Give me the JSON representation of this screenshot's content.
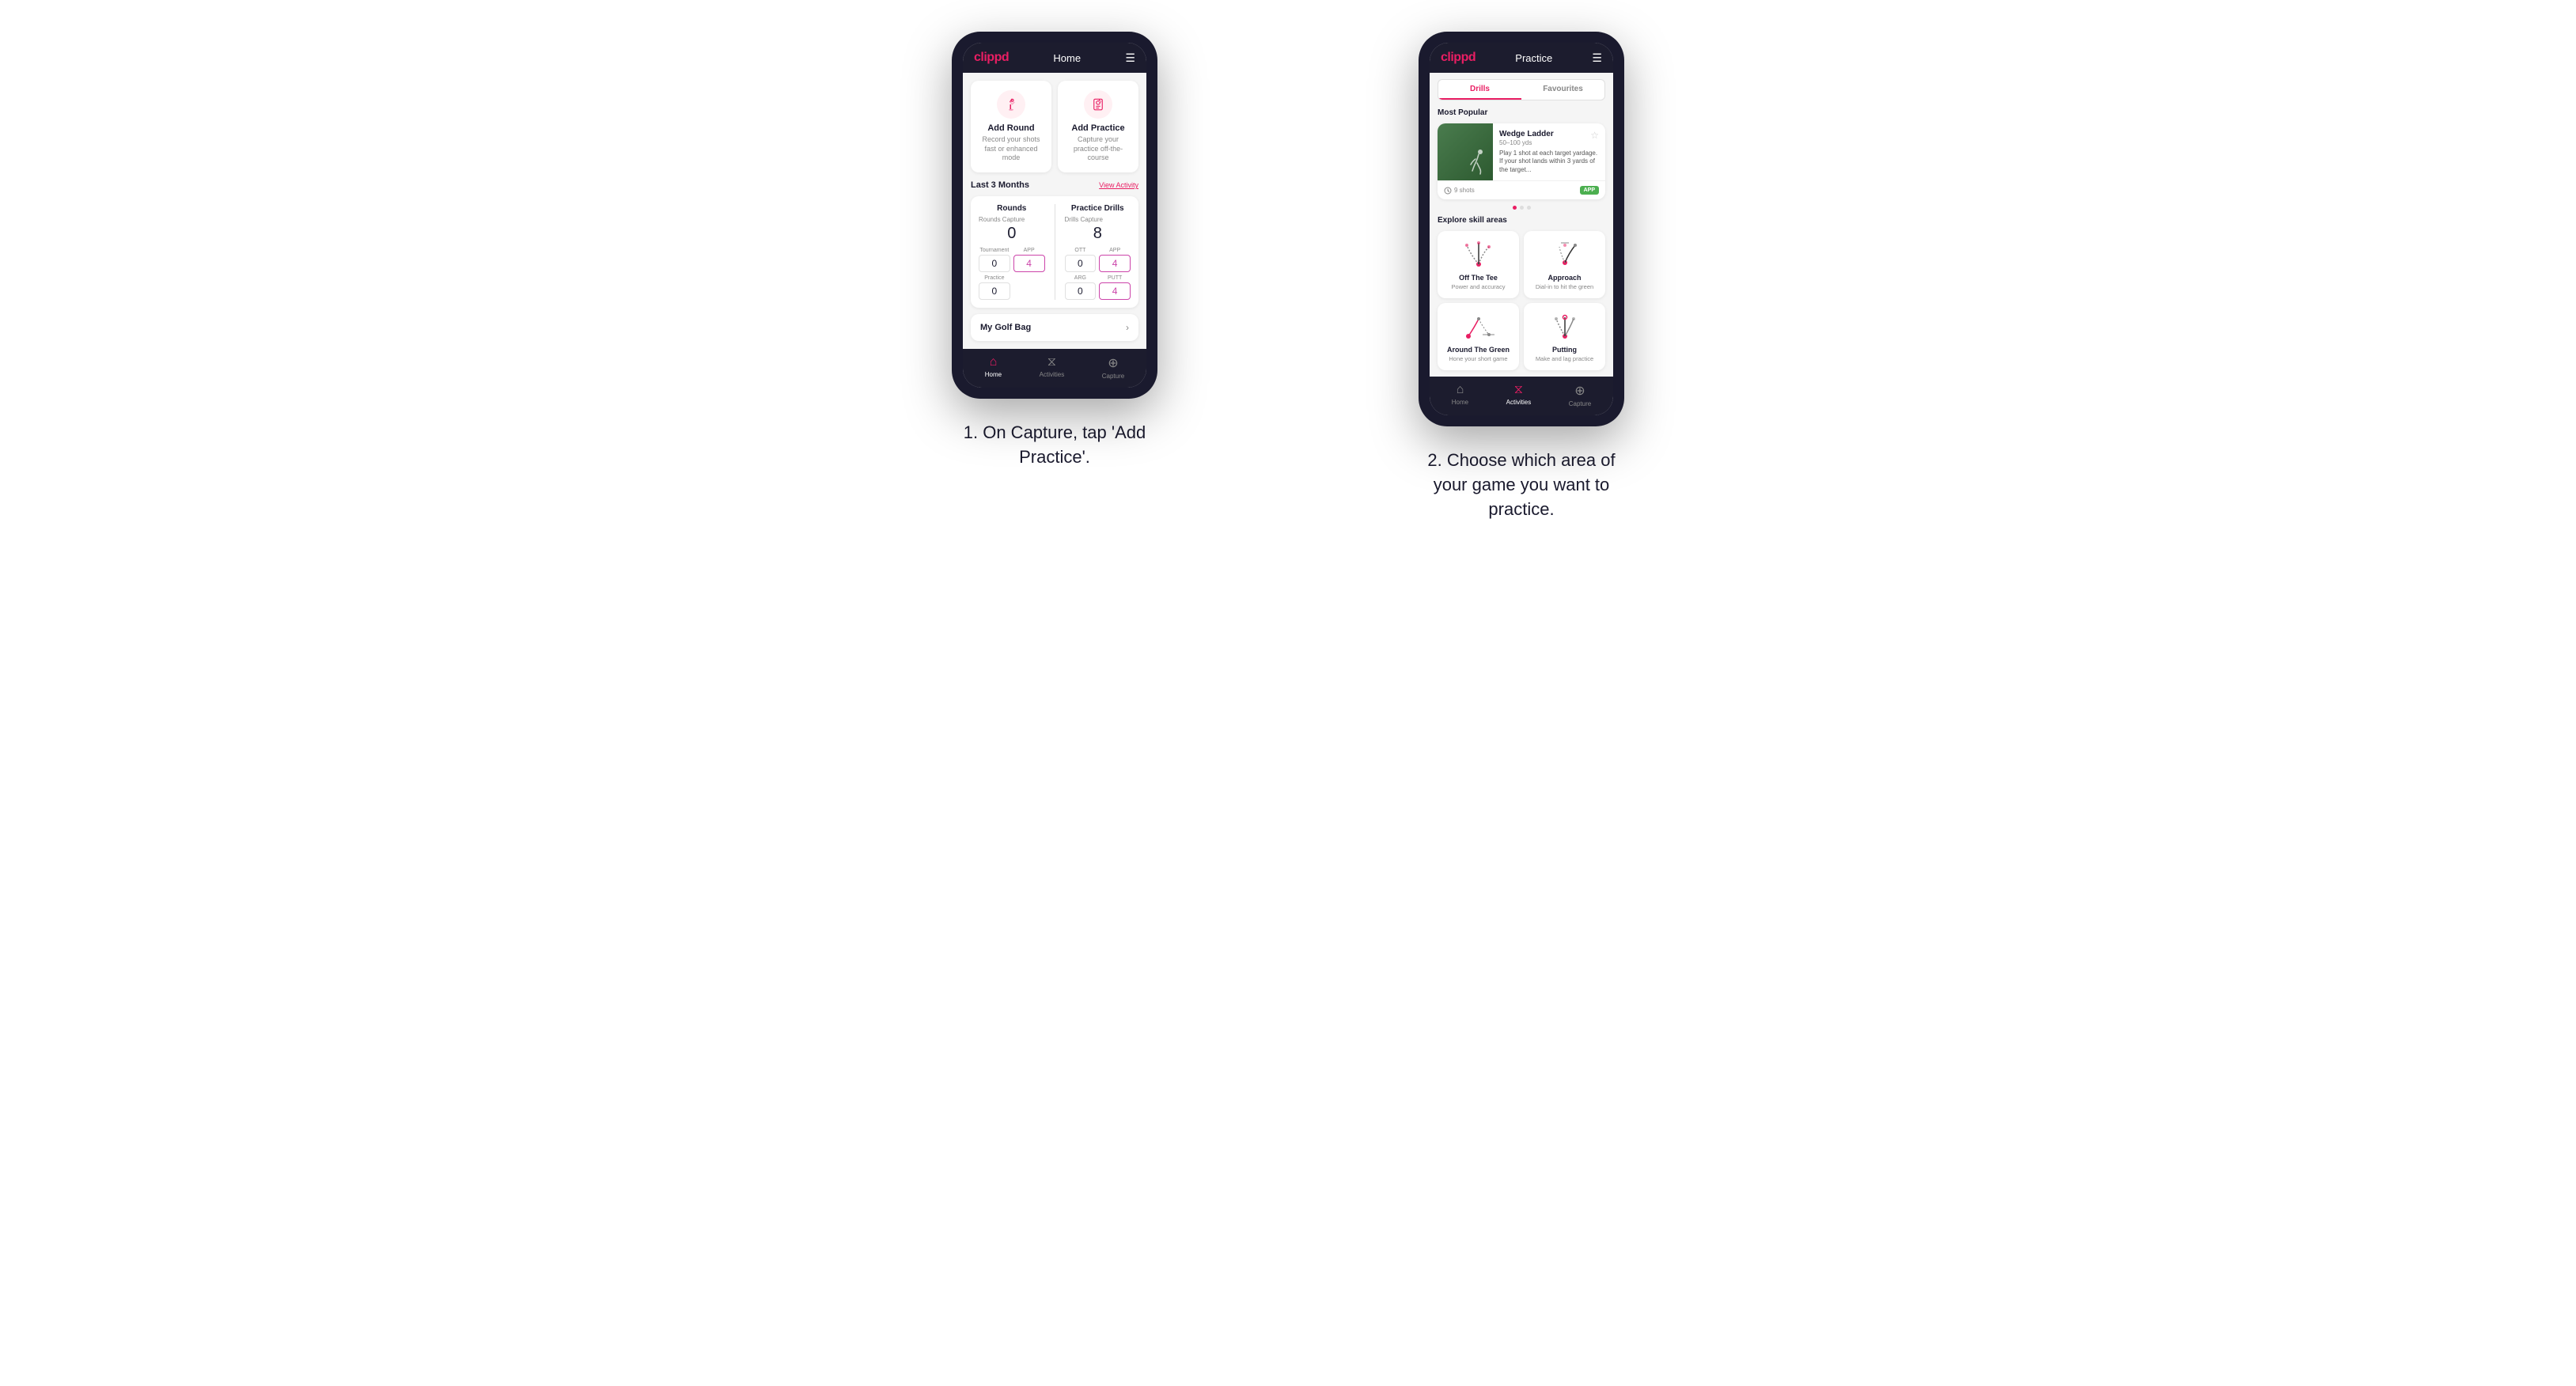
{
  "phone1": {
    "header": {
      "logo": "clippd",
      "title": "Home",
      "menu_icon": "☰"
    },
    "actions": [
      {
        "title": "Add Round",
        "desc": "Record your shots fast or enhanced mode",
        "icon": "⛳"
      },
      {
        "title": "Add Practice",
        "desc": "Capture your practice off-the-course",
        "icon": "🎯"
      }
    ],
    "stats_section": {
      "label": "Last 3 Months",
      "view_link": "View Activity",
      "rounds": {
        "title": "Rounds",
        "capture_label": "Rounds Capture",
        "value": "0",
        "sub_items": [
          {
            "label": "Tournament",
            "value": "0",
            "highlight": false
          },
          {
            "label": "APP",
            "value": "4",
            "highlight": true
          },
          {
            "label": "Practice",
            "value": "0",
            "highlight": false
          },
          {
            "label": "",
            "value": "",
            "highlight": false
          }
        ]
      },
      "drills": {
        "title": "Practice Drills",
        "capture_label": "Drills Capture",
        "value": "8",
        "sub_items": [
          {
            "label": "OTT",
            "value": "0",
            "highlight": false
          },
          {
            "label": "APP",
            "value": "4",
            "highlight": true
          },
          {
            "label": "ARG",
            "value": "0",
            "highlight": false
          },
          {
            "label": "PUTT",
            "value": "4",
            "highlight": true
          }
        ]
      }
    },
    "golf_bag": {
      "label": "My Golf Bag"
    },
    "bottom_nav": [
      {
        "label": "Home",
        "icon": "⌂",
        "active": true
      },
      {
        "label": "Activities",
        "icon": "⧖",
        "active": false
      },
      {
        "label": "Capture",
        "icon": "⊕",
        "active": false
      }
    ]
  },
  "phone2": {
    "header": {
      "logo": "clippd",
      "title": "Practice",
      "menu_icon": "☰"
    },
    "tabs": [
      {
        "label": "Drills",
        "active": true
      },
      {
        "label": "Favourites",
        "active": false
      }
    ],
    "most_popular_label": "Most Popular",
    "featured": {
      "title": "Wedge Ladder",
      "subtitle": "50–100 yds",
      "desc": "Play 1 shot at each target yardage. If your shot lands within 3 yards of the target...",
      "shots": "9 shots",
      "badge": "APP"
    },
    "explore_label": "Explore skill areas",
    "skills": [
      {
        "title": "Off The Tee",
        "desc": "Power and accuracy",
        "type": "ott"
      },
      {
        "title": "Approach",
        "desc": "Dial-in to hit the green",
        "type": "approach"
      },
      {
        "title": "Around The Green",
        "desc": "Hone your short game",
        "type": "atg"
      },
      {
        "title": "Putting",
        "desc": "Make and lag practice",
        "type": "putt"
      }
    ],
    "bottom_nav": [
      {
        "label": "Home",
        "icon": "⌂",
        "active": false
      },
      {
        "label": "Activities",
        "icon": "⧖",
        "active": true
      },
      {
        "label": "Capture",
        "icon": "⊕",
        "active": false
      }
    ]
  },
  "captions": [
    "1. On Capture, tap 'Add Practice'.",
    "2. Choose which area of your game you want to practice."
  ]
}
